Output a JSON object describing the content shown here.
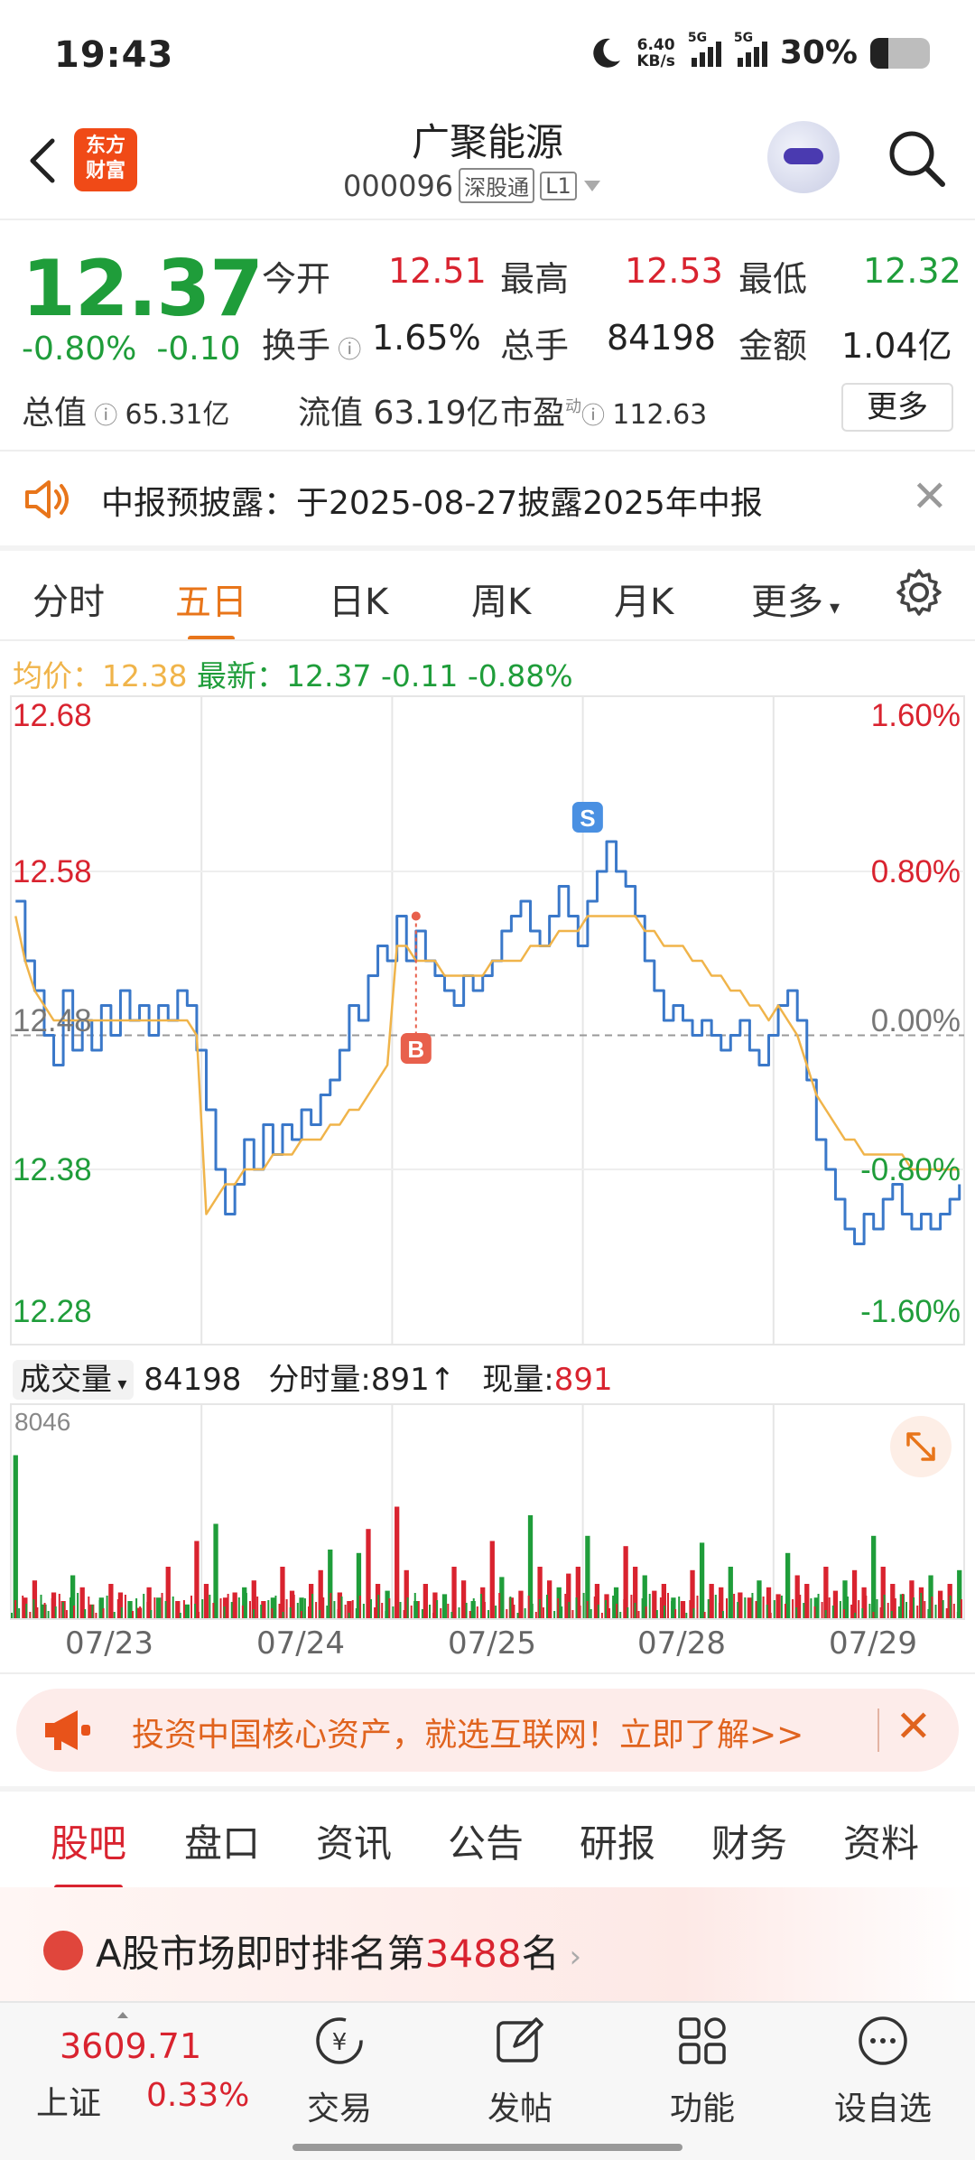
{
  "status_bar": {
    "time": "19:43",
    "net_speed_value": "6.40",
    "net_speed_unit": "KB/s",
    "signal1_label": "5G",
    "signal2_label": "5G",
    "battery": "30%",
    "battery_level": 0.3
  },
  "header": {
    "logo_line1": "东方",
    "logo_line2": "财富",
    "stock_name": "广聚能源",
    "stock_code": "000096",
    "tag_connect": "深股通",
    "tag_level": "L1",
    "icons": [
      "back-icon",
      "robot-avatar",
      "search-icon"
    ]
  },
  "quote": {
    "price": "12.37",
    "change_pct": "-0.80%",
    "change_amt": "-0.10",
    "open_label": "今开",
    "open": "12.51",
    "high_label": "最高",
    "high": "12.53",
    "low_label": "最低",
    "low": "12.32",
    "turnover_label": "换手",
    "turnover": "1.65%",
    "volume_label": "总手",
    "volume": "84198",
    "amount_label": "金额",
    "amount": "1.04亿",
    "mktcap_label": "总值",
    "mktcap": "65.31亿",
    "float_label": "流值",
    "float": "63.19亿",
    "pe_label": "市盈",
    "pe_sup": "动",
    "pe": "112.63",
    "more_label": "更多"
  },
  "notice": {
    "text": "中报预披露：于2025-08-27披露2025年中报",
    "icons": [
      "speaker-icon",
      "close-icon"
    ]
  },
  "period_tabs": {
    "items": [
      "分时",
      "五日",
      "日K",
      "周K",
      "月K",
      "更多"
    ],
    "active": "五日",
    "settings_icon": "gear-icon"
  },
  "price_summary": {
    "avg_label": "均价：",
    "avg": "12.38",
    "latest_label": "最新：",
    "latest": "12.37",
    "chg": "-0.11",
    "pct": "-0.88%"
  },
  "chart_data": {
    "type": "line",
    "title": "",
    "y_left_ticks": [
      "12.68",
      "12.58",
      "12.48",
      "12.38",
      "12.28"
    ],
    "y_right_ticks": [
      "1.60%",
      "0.80%",
      "0.00%",
      "-0.80%",
      "-1.60%"
    ],
    "ylim": [
      12.28,
      12.68
    ],
    "prev_close": 12.47,
    "x_categories": [
      "07/23",
      "07/24",
      "07/25",
      "07/28",
      "07/29"
    ],
    "series": [
      {
        "values": [
          12.56,
          12.52,
          12.5,
          12.47,
          12.45,
          12.5,
          12.46,
          12.48,
          12.46,
          12.49,
          12.47,
          12.5,
          12.48,
          12.49,
          12.47,
          12.49,
          12.48,
          12.5,
          12.49,
          12.46,
          12.42,
          12.38,
          12.35,
          12.37,
          12.4,
          12.38,
          12.41,
          12.39,
          12.41,
          12.4,
          12.42,
          12.41,
          12.43,
          12.44,
          12.46,
          12.49,
          12.48,
          12.51,
          12.53,
          12.52,
          12.55,
          12.52,
          12.54,
          12.52,
          12.51,
          12.5,
          12.49,
          12.51,
          12.5,
          12.51,
          12.52,
          12.54,
          12.55,
          12.56,
          12.54,
          12.53,
          12.55,
          12.57,
          12.55,
          12.53,
          12.56,
          12.58,
          12.6,
          12.58,
          12.57,
          12.55,
          12.52,
          12.5,
          12.48,
          12.49,
          12.48,
          12.47,
          12.48,
          12.47,
          12.46,
          12.47,
          12.48,
          12.46,
          12.45,
          12.47,
          12.49,
          12.5,
          12.48,
          12.44,
          12.4,
          12.38,
          12.36,
          12.34,
          12.33,
          12.35,
          12.34,
          12.36,
          12.37,
          12.35,
          12.34,
          12.35,
          12.34,
          12.35,
          12.36,
          12.37
        ]
      },
      {
        "values": [
          12.55,
          12.52,
          12.5,
          12.49,
          12.48,
          12.48,
          12.48,
          12.48,
          12.48,
          12.48,
          12.48,
          12.48,
          12.48,
          12.48,
          12.48,
          12.48,
          12.48,
          12.48,
          12.48,
          12.47,
          12.35,
          12.36,
          12.37,
          12.37,
          12.38,
          12.38,
          12.38,
          12.39,
          12.39,
          12.39,
          12.4,
          12.4,
          12.4,
          12.41,
          12.41,
          12.42,
          12.42,
          12.43,
          12.44,
          12.45,
          12.53,
          12.53,
          12.52,
          12.52,
          12.52,
          12.51,
          12.51,
          12.51,
          12.51,
          12.51,
          12.52,
          12.52,
          12.52,
          12.52,
          12.53,
          12.53,
          12.53,
          12.54,
          12.54,
          12.54,
          12.55,
          12.55,
          12.55,
          12.55,
          12.55,
          12.55,
          12.54,
          12.54,
          12.53,
          12.53,
          12.53,
          12.52,
          12.52,
          12.51,
          12.51,
          12.5,
          12.5,
          12.49,
          12.49,
          12.48,
          12.49,
          12.48,
          12.47,
          12.45,
          12.43,
          12.42,
          12.41,
          12.4,
          12.4,
          12.39,
          12.39,
          12.39,
          12.39,
          12.39,
          12.38,
          12.38,
          12.38,
          12.38,
          12.38,
          12.38
        ]
      }
    ],
    "markers": [
      {
        "label": "S",
        "x_index": 60,
        "y": 12.6
      },
      {
        "label": "B",
        "x_index": 42,
        "y": 12.48
      }
    ],
    "colors": {
      "price": "#3a78c9",
      "avg": "#f0b44a",
      "up": "#d9232f",
      "down": "#1f9d3a"
    }
  },
  "volume": {
    "label": "成交量",
    "total": "84198",
    "minute_label": "分时量:",
    "minute_value": "891",
    "minute_arrow": "↑",
    "current_label": "现量:",
    "current_value": "891",
    "max_label": "8046",
    "expand_icon": "expand-icon",
    "bars": [
      0.95,
      0.12,
      0.22,
      0.08,
      0.15,
      0.1,
      0.25,
      0.18,
      0.08,
      0.12,
      0.2,
      0.15,
      0.1,
      0.06,
      0.18,
      0.12,
      0.3,
      0.1,
      0.08,
      0.45,
      0.2,
      0.55,
      0.12,
      0.15,
      0.18,
      0.22,
      0.1,
      0.12,
      0.3,
      0.16,
      0.12,
      0.2,
      0.28,
      0.4,
      0.15,
      0.1,
      0.38,
      0.52,
      0.2,
      0.16,
      0.65,
      0.28,
      0.1,
      0.2,
      0.15,
      0.14,
      0.3,
      0.22,
      0.1,
      0.18,
      0.45,
      0.24,
      0.12,
      0.16,
      0.6,
      0.3,
      0.22,
      0.18,
      0.26,
      0.3,
      0.48,
      0.2,
      0.14,
      0.18,
      0.42,
      0.3,
      0.25,
      0.16,
      0.2,
      0.12,
      0.1,
      0.28,
      0.44,
      0.2,
      0.18,
      0.3,
      0.15,
      0.12,
      0.22,
      0.18,
      0.14,
      0.38,
      0.25,
      0.2,
      0.12,
      0.3,
      0.16,
      0.22,
      0.28,
      0.18,
      0.48,
      0.3,
      0.2,
      0.14,
      0.22,
      0.18,
      0.25,
      0.16,
      0.2,
      0.28
    ]
  },
  "ad": {
    "text": "投资中国核心资产，就选互联网！立即了解>>",
    "icons": [
      "megaphone-icon",
      "close-icon"
    ]
  },
  "bottom_tabs": {
    "items": [
      "股吧",
      "盘口",
      "资讯",
      "公告",
      "研报",
      "财务",
      "资料"
    ],
    "active": "股吧"
  },
  "rank": {
    "prefix": "A股市场即时排名第",
    "number": "3488",
    "suffix": "名"
  },
  "footer": {
    "index_value": "3609.71",
    "index_name": "上证",
    "index_pct": "0.33%",
    "buttons": [
      {
        "label": "交易",
        "icon": "trade-icon"
      },
      {
        "label": "发帖",
        "icon": "edit-icon"
      },
      {
        "label": "功能",
        "icon": "grid-icon"
      },
      {
        "label": "设自选",
        "icon": "add-watchlist-icon"
      }
    ]
  }
}
